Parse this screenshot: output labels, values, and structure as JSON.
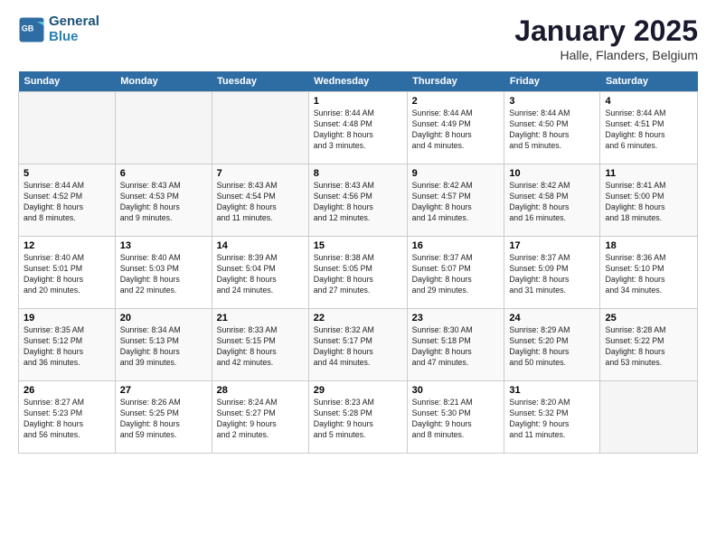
{
  "header": {
    "logo_line1": "General",
    "logo_line2": "Blue",
    "month": "January 2025",
    "location": "Halle, Flanders, Belgium"
  },
  "weekdays": [
    "Sunday",
    "Monday",
    "Tuesday",
    "Wednesday",
    "Thursday",
    "Friday",
    "Saturday"
  ],
  "weeks": [
    [
      {
        "day": "",
        "info": ""
      },
      {
        "day": "",
        "info": ""
      },
      {
        "day": "",
        "info": ""
      },
      {
        "day": "1",
        "info": "Sunrise: 8:44 AM\nSunset: 4:48 PM\nDaylight: 8 hours\nand 3 minutes."
      },
      {
        "day": "2",
        "info": "Sunrise: 8:44 AM\nSunset: 4:49 PM\nDaylight: 8 hours\nand 4 minutes."
      },
      {
        "day": "3",
        "info": "Sunrise: 8:44 AM\nSunset: 4:50 PM\nDaylight: 8 hours\nand 5 minutes."
      },
      {
        "day": "4",
        "info": "Sunrise: 8:44 AM\nSunset: 4:51 PM\nDaylight: 8 hours\nand 6 minutes."
      }
    ],
    [
      {
        "day": "5",
        "info": "Sunrise: 8:44 AM\nSunset: 4:52 PM\nDaylight: 8 hours\nand 8 minutes."
      },
      {
        "day": "6",
        "info": "Sunrise: 8:43 AM\nSunset: 4:53 PM\nDaylight: 8 hours\nand 9 minutes."
      },
      {
        "day": "7",
        "info": "Sunrise: 8:43 AM\nSunset: 4:54 PM\nDaylight: 8 hours\nand 11 minutes."
      },
      {
        "day": "8",
        "info": "Sunrise: 8:43 AM\nSunset: 4:56 PM\nDaylight: 8 hours\nand 12 minutes."
      },
      {
        "day": "9",
        "info": "Sunrise: 8:42 AM\nSunset: 4:57 PM\nDaylight: 8 hours\nand 14 minutes."
      },
      {
        "day": "10",
        "info": "Sunrise: 8:42 AM\nSunset: 4:58 PM\nDaylight: 8 hours\nand 16 minutes."
      },
      {
        "day": "11",
        "info": "Sunrise: 8:41 AM\nSunset: 5:00 PM\nDaylight: 8 hours\nand 18 minutes."
      }
    ],
    [
      {
        "day": "12",
        "info": "Sunrise: 8:40 AM\nSunset: 5:01 PM\nDaylight: 8 hours\nand 20 minutes."
      },
      {
        "day": "13",
        "info": "Sunrise: 8:40 AM\nSunset: 5:03 PM\nDaylight: 8 hours\nand 22 minutes."
      },
      {
        "day": "14",
        "info": "Sunrise: 8:39 AM\nSunset: 5:04 PM\nDaylight: 8 hours\nand 24 minutes."
      },
      {
        "day": "15",
        "info": "Sunrise: 8:38 AM\nSunset: 5:05 PM\nDaylight: 8 hours\nand 27 minutes."
      },
      {
        "day": "16",
        "info": "Sunrise: 8:37 AM\nSunset: 5:07 PM\nDaylight: 8 hours\nand 29 minutes."
      },
      {
        "day": "17",
        "info": "Sunrise: 8:37 AM\nSunset: 5:09 PM\nDaylight: 8 hours\nand 31 minutes."
      },
      {
        "day": "18",
        "info": "Sunrise: 8:36 AM\nSunset: 5:10 PM\nDaylight: 8 hours\nand 34 minutes."
      }
    ],
    [
      {
        "day": "19",
        "info": "Sunrise: 8:35 AM\nSunset: 5:12 PM\nDaylight: 8 hours\nand 36 minutes."
      },
      {
        "day": "20",
        "info": "Sunrise: 8:34 AM\nSunset: 5:13 PM\nDaylight: 8 hours\nand 39 minutes."
      },
      {
        "day": "21",
        "info": "Sunrise: 8:33 AM\nSunset: 5:15 PM\nDaylight: 8 hours\nand 42 minutes."
      },
      {
        "day": "22",
        "info": "Sunrise: 8:32 AM\nSunset: 5:17 PM\nDaylight: 8 hours\nand 44 minutes."
      },
      {
        "day": "23",
        "info": "Sunrise: 8:30 AM\nSunset: 5:18 PM\nDaylight: 8 hours\nand 47 minutes."
      },
      {
        "day": "24",
        "info": "Sunrise: 8:29 AM\nSunset: 5:20 PM\nDaylight: 8 hours\nand 50 minutes."
      },
      {
        "day": "25",
        "info": "Sunrise: 8:28 AM\nSunset: 5:22 PM\nDaylight: 8 hours\nand 53 minutes."
      }
    ],
    [
      {
        "day": "26",
        "info": "Sunrise: 8:27 AM\nSunset: 5:23 PM\nDaylight: 8 hours\nand 56 minutes."
      },
      {
        "day": "27",
        "info": "Sunrise: 8:26 AM\nSunset: 5:25 PM\nDaylight: 8 hours\nand 59 minutes."
      },
      {
        "day": "28",
        "info": "Sunrise: 8:24 AM\nSunset: 5:27 PM\nDaylight: 9 hours\nand 2 minutes."
      },
      {
        "day": "29",
        "info": "Sunrise: 8:23 AM\nSunset: 5:28 PM\nDaylight: 9 hours\nand 5 minutes."
      },
      {
        "day": "30",
        "info": "Sunrise: 8:21 AM\nSunset: 5:30 PM\nDaylight: 9 hours\nand 8 minutes."
      },
      {
        "day": "31",
        "info": "Sunrise: 8:20 AM\nSunset: 5:32 PM\nDaylight: 9 hours\nand 11 minutes."
      },
      {
        "day": "",
        "info": ""
      }
    ]
  ]
}
